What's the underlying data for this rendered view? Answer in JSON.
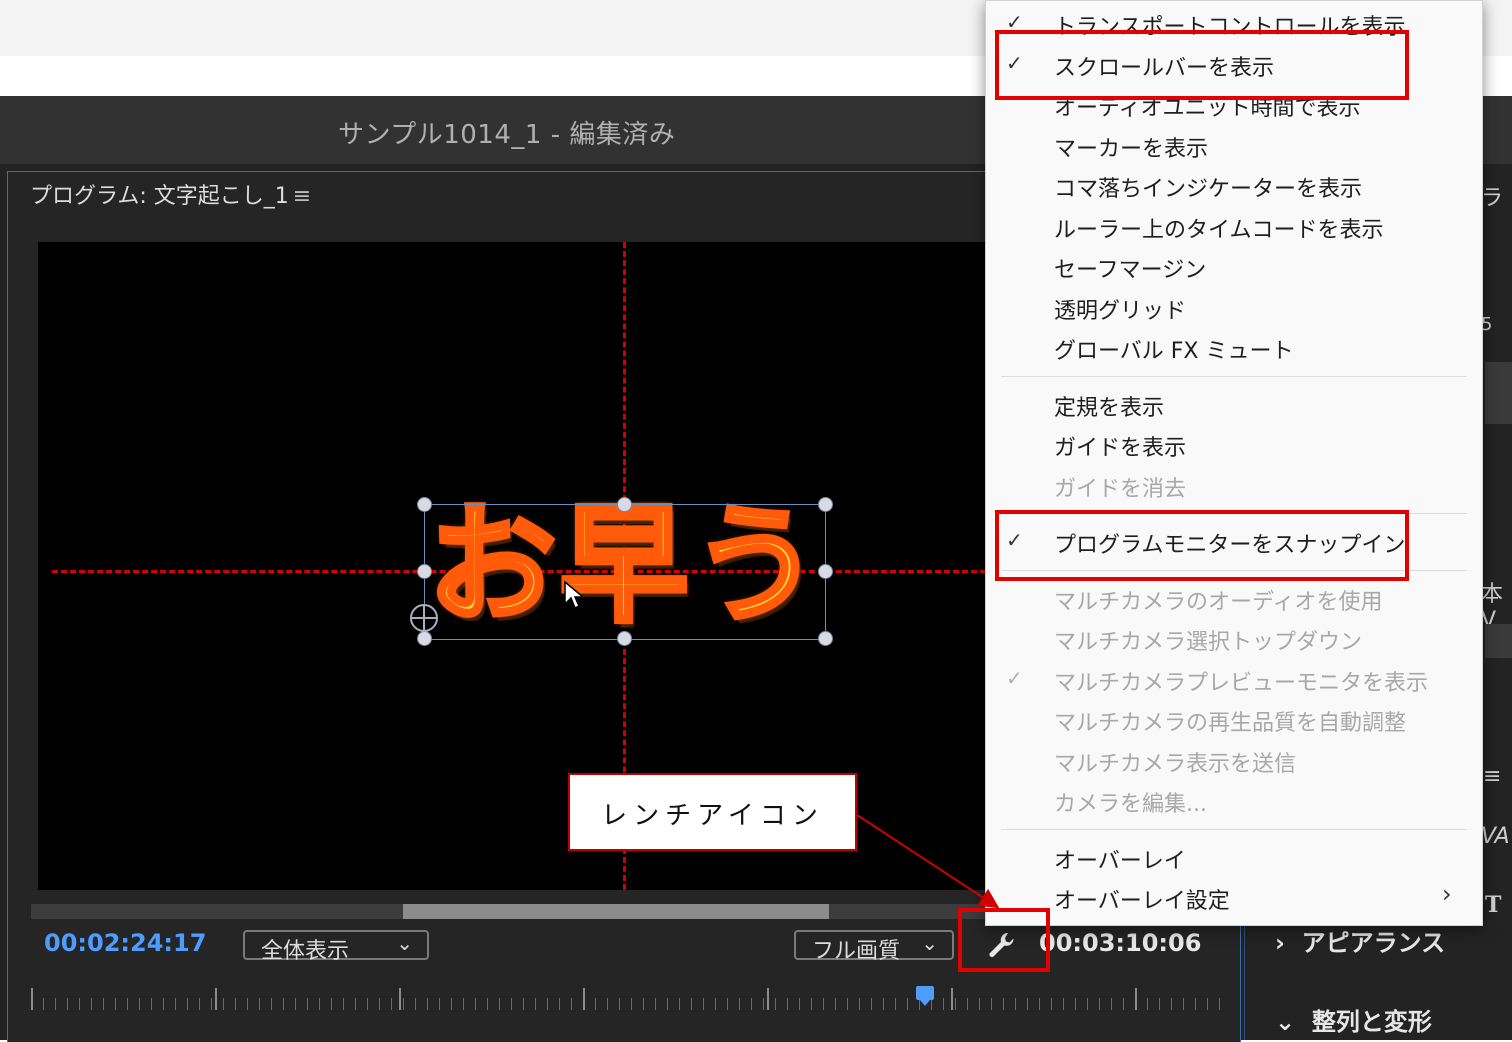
{
  "window": {
    "title": "サンプル1014_1 - 編集済み"
  },
  "program_monitor": {
    "header": "プログラム: 文字起こし_1",
    "menu_glyph": "≡",
    "caption_text": "お早う",
    "timecode_current": "00:02:24:17",
    "zoom_dropdown": "全体表示",
    "quality_dropdown": "フル画質",
    "timecode_total": "00:03:10:06",
    "scroll_position": 0.42
  },
  "right_panel": {
    "fragments": [
      "ラ",
      "5",
      "本V",
      "≡",
      "VA",
      "T"
    ],
    "sections": [
      {
        "chevron": "›",
        "label": "アピアランス"
      },
      {
        "chevron": "⌄",
        "label": "整列と変形"
      }
    ]
  },
  "context_menu": {
    "groups": [
      [
        {
          "label": "トランスポートコントロールを表示",
          "checked": true,
          "enabled": true
        },
        {
          "label": "スクロールバーを表示",
          "checked": true,
          "enabled": true
        },
        {
          "label": "オーディオユニット時間で表示",
          "checked": false,
          "enabled": true
        },
        {
          "label": "マーカーを表示",
          "checked": false,
          "enabled": true
        },
        {
          "label": "コマ落ちインジケーターを表示",
          "checked": false,
          "enabled": true
        },
        {
          "label": "ルーラー上のタイムコードを表示",
          "checked": false,
          "enabled": true
        },
        {
          "label": "セーフマージン",
          "checked": false,
          "enabled": true
        },
        {
          "label": "透明グリッド",
          "checked": false,
          "enabled": true
        },
        {
          "label": "グローバル FX ミュート",
          "checked": false,
          "enabled": true
        }
      ],
      [
        {
          "label": "定規を表示",
          "checked": false,
          "enabled": true
        },
        {
          "label": "ガイドを表示",
          "checked": false,
          "enabled": true
        },
        {
          "label": "ガイドを消去",
          "checked": false,
          "enabled": false
        }
      ],
      [
        {
          "label": "プログラムモニターをスナップイン",
          "checked": true,
          "enabled": true
        }
      ],
      [
        {
          "label": "マルチカメラのオーディオを使用",
          "checked": false,
          "enabled": false
        },
        {
          "label": "マルチカメラ選択トップダウン",
          "checked": false,
          "enabled": false
        },
        {
          "label": "マルチカメラプレビューモニタを表示",
          "checked": true,
          "enabled": false
        },
        {
          "label": "マルチカメラの再生品質を自動調整",
          "checked": false,
          "enabled": false
        },
        {
          "label": "マルチカメラ表示を送信",
          "checked": false,
          "enabled": false
        },
        {
          "label": "カメラを編集...",
          "checked": false,
          "enabled": false
        }
      ],
      [
        {
          "label": "オーバーレイ",
          "checked": false,
          "enabled": true
        },
        {
          "label": "オーバーレイ設定",
          "checked": false,
          "enabled": true,
          "submenu": true
        }
      ]
    ],
    "check_glyph": "✓",
    "submenu_glyph": "›"
  },
  "annotation": {
    "callout_text": "レンチアイコン",
    "highlight_color": "#e30000"
  },
  "icons": {
    "wrench": "wrench-icon",
    "chevron": "chevron-down-icon"
  },
  "colors": {
    "accent_blue": "#4d9dff",
    "guide_red": "#d40000",
    "caption_fill": "#ffd33a",
    "caption_stroke": "#ff5b0a"
  }
}
